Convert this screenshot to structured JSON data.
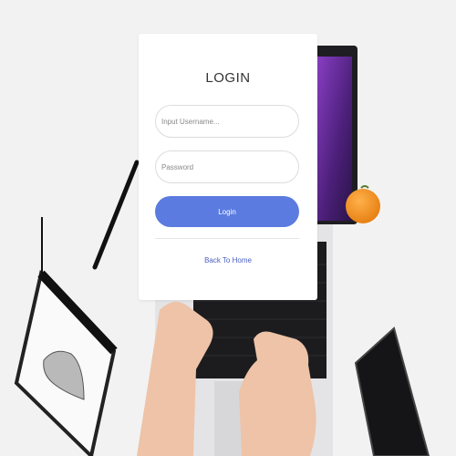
{
  "login": {
    "title": "LOGIN",
    "username_placeholder": "Input Username...",
    "password_placeholder": "Password",
    "login_button": "Login",
    "back_link": "Back To Home"
  },
  "colors": {
    "button": "#5b7be0",
    "link": "#4a5fc1",
    "background": "#f1f1f1",
    "laptop_screen": "#5a2b8a",
    "orange": "#f08a1c"
  }
}
